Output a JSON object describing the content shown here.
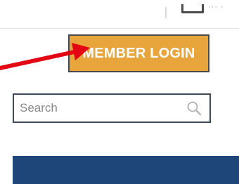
{
  "header": {
    "member_login_label": "MEMBER LOGIN"
  },
  "search": {
    "placeholder": "Search"
  },
  "annotation": {
    "arrow_color": "#e30613"
  },
  "colors": {
    "login_button": "#e8a53c",
    "nav_band": "#1e4679",
    "search_border": "#3c4a5a"
  },
  "icons": {
    "search": "search-icon",
    "top_utility": "cart-icon"
  }
}
